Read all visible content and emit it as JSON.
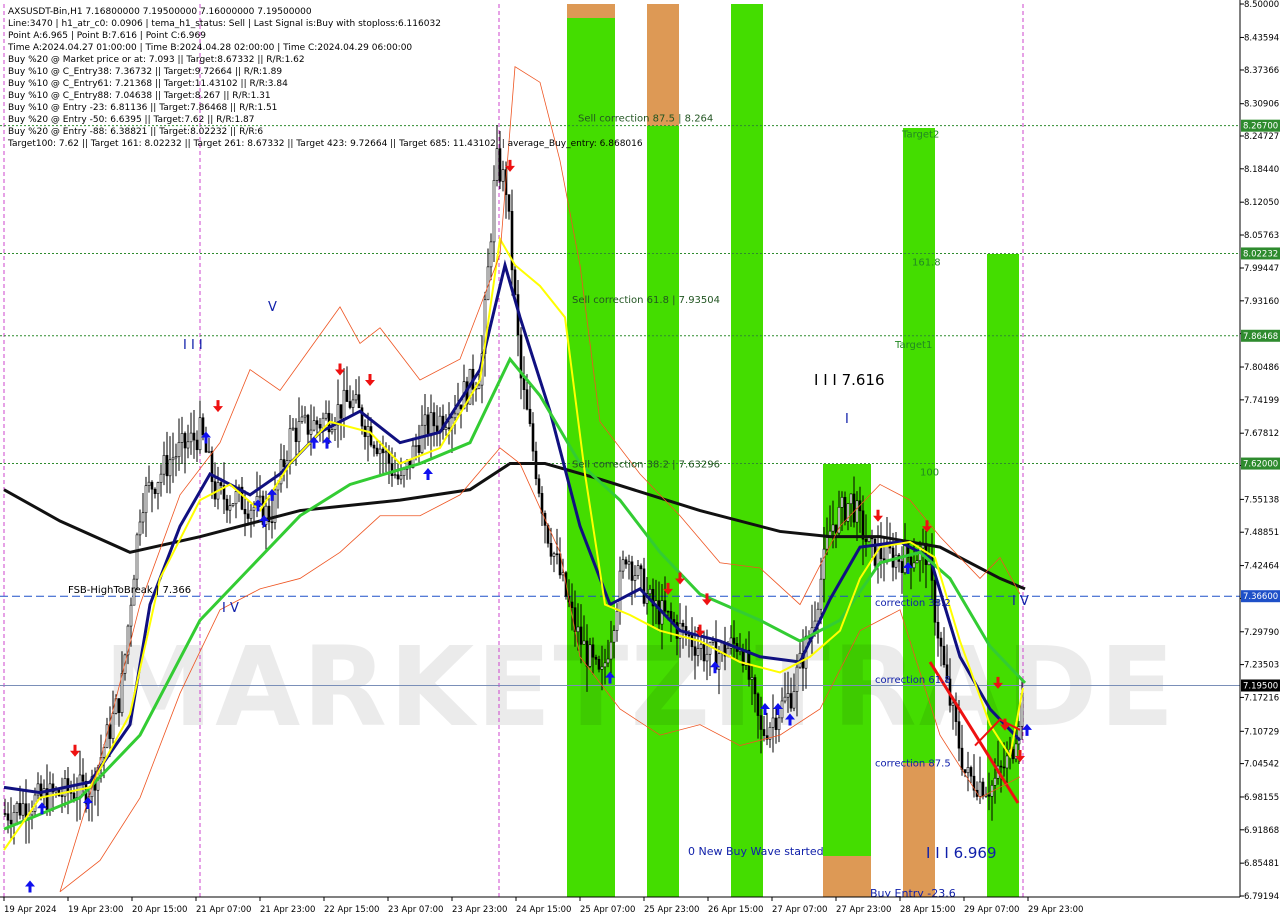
{
  "chart_data": {
    "type": "candlestick",
    "symbol_line": "AXSUSDT-Bin,H1  7.16800000 7.19500000 7.16000000 7.19500000",
    "info_lines": [
      "Line:3470 | h1_atr_c0: 0.0906 | tema_h1_status: Sell | Last Signal is:Buy with stoploss:6.116032",
      "Point A:6.965 | Point B:7.616 | Point C:6.969",
      "Time A:2024.04.27 01:00:00 | Time B:2024.04.28 02:00:00 | Time C:2024.04.29 06:00:00",
      "Buy %20 @ Market price or at: 7.093 || Target:8.67332 || R/R:1.62",
      "Buy %10 @ C_Entry38: 7.36732 || Target:9.72664 || R/R:1.89",
      "Buy %10 @ C_Entry61: 7.21368 || Target:11.43102 || R/R:3.84",
      "Buy %10 @ C_Entry88: 7.04638 || Target:8.267 || R/R:1.31",
      "Buy %10 @ Entry -23: 6.81136 || Target:7.86468 || R/R:1.51",
      "Buy %20 @ Entry -50: 6.6395 || Target:7.62 || R/R:1.87",
      "Buy %20 @ Entry -88: 6.38821 || Target:8.02232 || R/R:6",
      "Target100: 7.62 || Target 161: 8.02232 || Target 261: 8.67332 || Target 423: 9.72664 || Target 685: 11.43102 || average_Buy_entry: 6.868016"
    ],
    "y_axis": {
      "min": 6.79,
      "max": 8.5,
      "tick_labels": [
        "8.50000",
        "8.43594",
        "8.37366",
        "8.30906",
        "8.24727",
        "8.18440",
        "8.12050",
        "8.05763",
        "7.99447",
        "7.93160",
        "7.86873",
        "7.80486",
        "7.74199",
        "7.67812",
        "7.61625",
        "7.55138",
        "7.48851",
        "7.42464",
        "7.36177",
        "7.29790",
        "7.23503",
        "7.17216",
        "7.10729",
        "7.04542",
        "6.98155",
        "6.91868",
        "6.85481",
        "6.79194"
      ],
      "tick_values": [
        8.5,
        8.43594,
        8.37366,
        8.30906,
        8.24727,
        8.1844,
        8.1205,
        8.05763,
        7.99447,
        7.9316,
        7.86873,
        7.80486,
        7.74199,
        7.67812,
        7.61625,
        7.55138,
        7.48851,
        7.42464,
        7.36177,
        7.2979,
        7.23503,
        7.17216,
        7.10729,
        7.04542,
        6.98155,
        6.91868,
        6.85481,
        6.79194
      ]
    },
    "x_axis": {
      "tick_labels": [
        "19 Apr 2024",
        "19 Apr 23:00",
        "20 Apr 15:00",
        "21 Apr 07:00",
        "21 Apr 23:00",
        "22 Apr 15:00",
        "23 Apr 07:00",
        "23 Apr 23:00",
        "24 Apr 15:00",
        "25 Apr 07:00",
        "25 Apr 23:00",
        "26 Apr 15:00",
        "27 Apr 07:00",
        "27 Apr 23:00",
        "28 Apr 15:00",
        "29 Apr 07:00",
        "29 Apr 23:00"
      ]
    },
    "price_tags": [
      {
        "label": "8.26700",
        "value": 8.267,
        "color": "#2e8b2e"
      },
      {
        "label": "8.02232",
        "value": 8.02232,
        "color": "#2e8b2e"
      },
      {
        "label": "7.86468",
        "value": 7.86468,
        "color": "#2e8b2e"
      },
      {
        "label": "7.62000",
        "value": 7.62,
        "color": "#2e8b2e"
      },
      {
        "label": "7.36600",
        "value": 7.366,
        "color": "#1e50c8"
      },
      {
        "label": "7.19500",
        "value": 7.195,
        "color": "#000000"
      }
    ],
    "levels": [
      {
        "label": "Sell correction 87.5 | 8.264",
        "value": 8.267
      },
      {
        "label": "Sell correction 61.8 | 7.93504",
        "value": 7.93504
      },
      {
        "label": "Sell correction 38.2 | 7.63296",
        "value": 7.62
      },
      {
        "label": "FSB-HighToBreak | 7.366",
        "value": 7.366
      },
      {
        "label": "161.8",
        "value": 8.02232
      },
      {
        "label": "Target1",
        "value": 7.86468
      },
      {
        "label": "Target2",
        "value": 8.267
      },
      {
        "label": "100",
        "value": 7.62
      },
      {
        "label": "correction 38.2",
        "value": 7.366
      },
      {
        "label": "correction 61.8",
        "value": 7.2
      },
      {
        "label": "correction 87.5",
        "value": 7.04
      }
    ],
    "annotations": [
      {
        "text": "I I I 7.616"
      },
      {
        "text": "I I I 6.969"
      },
      {
        "text": "0 New Buy Wave started"
      },
      {
        "text": "Buy Entry -23.6"
      },
      {
        "text": "I V"
      },
      {
        "text": "I"
      },
      {
        "text": "I I I"
      },
      {
        "text": "V"
      },
      {
        "text": "I V"
      }
    ],
    "watermark": "MARKETZITRADE",
    "colors": {
      "zone_green": "#44dd00",
      "zone_orange": "#dd9955",
      "ma_black": "#111111",
      "ma_navy": "#101080",
      "ma_green": "#33cc33",
      "ma_yellow": "#ffff00",
      "buy_arrow": "#1010ee",
      "sell_arrow": "#ee1111"
    }
  }
}
